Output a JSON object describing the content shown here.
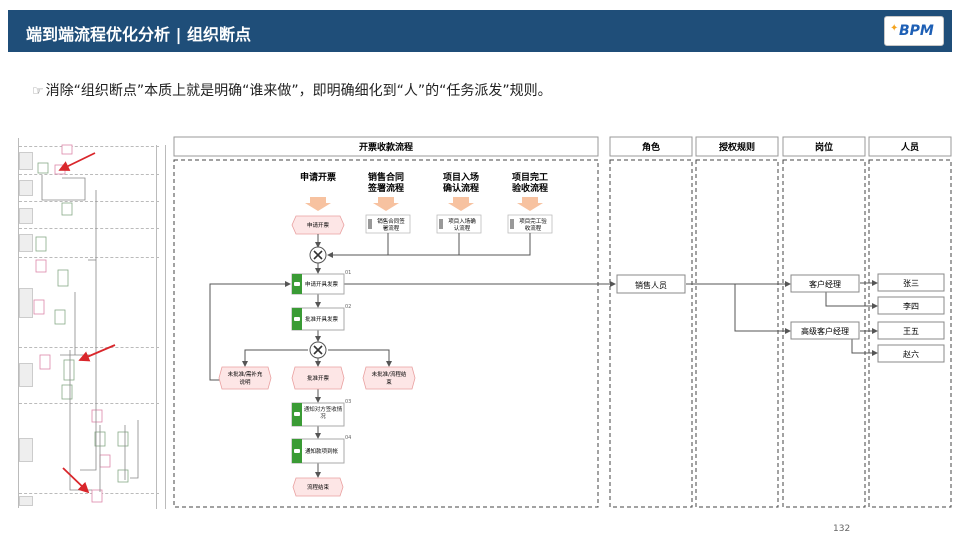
{
  "header": {
    "title": "端到端流程优化分析 | 组织断点",
    "logo_text": "BPM"
  },
  "subtitle": "消除“组织断点”本质上就是明确“谁来做”，即明确细化到“人”的“任务派发”规则。",
  "page_number": "132",
  "columns": {
    "process": "开票收款流程",
    "role": "角色",
    "rule": "授权规则",
    "post": "岗位",
    "person": "人员"
  },
  "triggers": [
    {
      "line1": "申请开票",
      "line2": "",
      "box1": "申请开票",
      "box2": ""
    },
    {
      "line1": "销售合同",
      "line2": "签署流程",
      "box1": "销售合同签",
      "box2": "署流程"
    },
    {
      "line1": "项目入场",
      "line2": "确认流程",
      "box1": "项目入场确",
      "box2": "认流程"
    },
    {
      "line1": "项目完工",
      "line2": "验收流程",
      "box1": "项目完工验",
      "box2": "收流程"
    }
  ],
  "steps": [
    {
      "no": "01",
      "label": "申请开具发票"
    },
    {
      "no": "02",
      "label": "批准开具发票"
    },
    {
      "no": "03",
      "label": "通知对方签收情况"
    },
    {
      "no": "04",
      "label": "通知款项到帐"
    }
  ],
  "branches": {
    "left_l1": "未批准/需补充",
    "left_l2": "说明",
    "middle": "批准开票",
    "right_l1": "未批准/流程结",
    "right_l2": "束"
  },
  "end_label": "流程结束",
  "role_label": "销售人员",
  "posts": [
    "客户经理",
    "高级客户经理"
  ],
  "persons": [
    "张三",
    "李四",
    "王五",
    "赵六"
  ],
  "colors": {
    "header_bg": "#1f4e79",
    "step_icon": "#3a9b35",
    "trigger_arrow": "#f7c2a0",
    "trigger_box": "#fde6e6",
    "red_arrow": "#d9262b"
  }
}
